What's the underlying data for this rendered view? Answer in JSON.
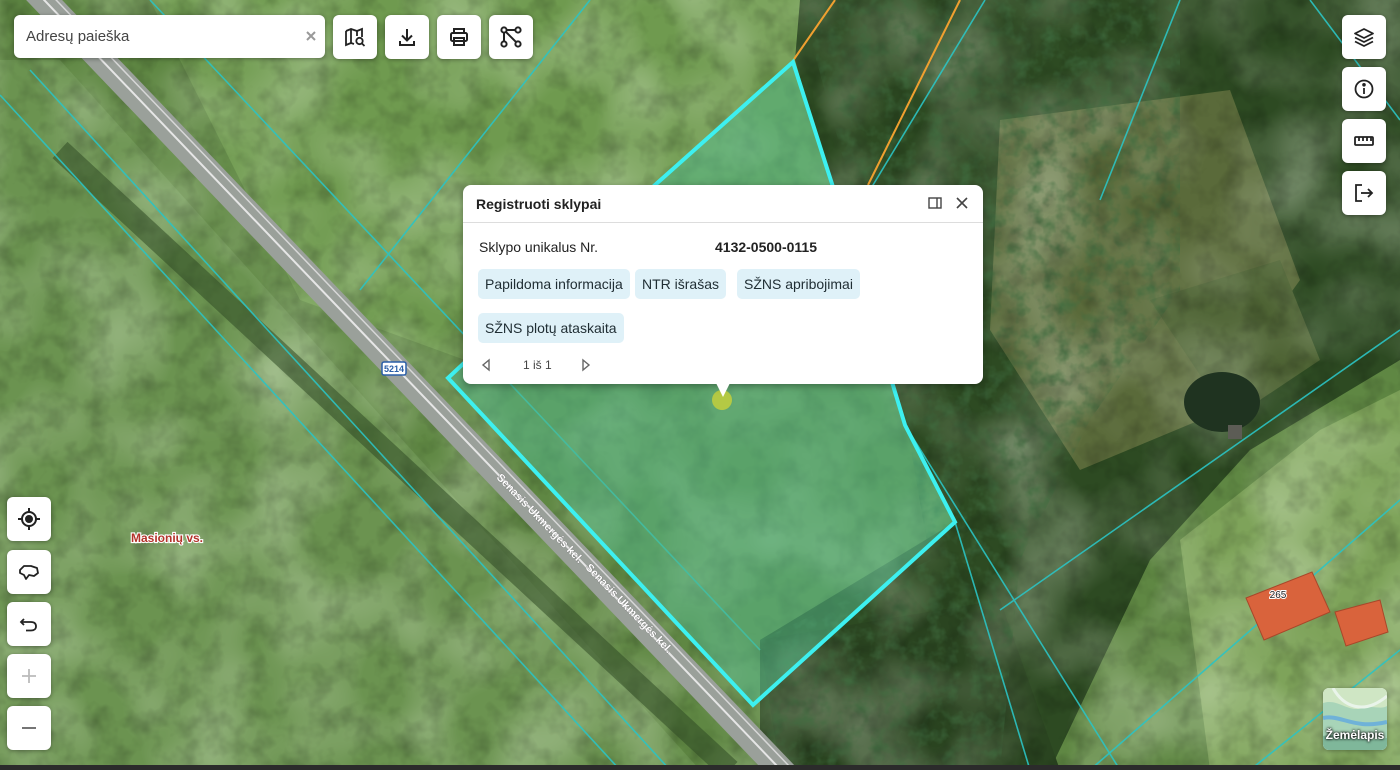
{
  "search": {
    "placeholder": "Adresų paieška",
    "value": ""
  },
  "toolbar": {
    "buttons": [
      {
        "name": "map-search-icon"
      },
      {
        "name": "download-icon"
      },
      {
        "name": "print-icon"
      },
      {
        "name": "route-icon"
      }
    ]
  },
  "right_controls": [
    {
      "name": "layers-icon"
    },
    {
      "name": "info-icon"
    },
    {
      "name": "ruler-icon"
    },
    {
      "name": "logout-icon"
    }
  ],
  "left_controls": [
    {
      "name": "locate-icon"
    },
    {
      "name": "lasso-icon"
    },
    {
      "name": "undo-icon"
    },
    {
      "name": "plus-icon"
    },
    {
      "name": "minus-icon"
    }
  ],
  "popup": {
    "title": "Registruoti sklypai",
    "field_label": "Sklypo unikalus Nr.",
    "field_value": "4132-0500-0115",
    "buttons": [
      "Papildoma informacija",
      "NTR išrašas",
      "SŽNS apribojimai",
      "SŽNS plotų ataskaita"
    ],
    "pagination": "1 iš 1"
  },
  "map_labels": {
    "road_number": "5214",
    "road_name": "Senasis Ukmergės kel.",
    "village": "Masionių vs.",
    "house_number": "265"
  },
  "basemap": {
    "label": "Žemėlapis"
  },
  "colors": {
    "parcel_outline": "#3df0f0",
    "parcel_fill": "#56b889",
    "boundary_line": "#2bc4c4",
    "utility_line": "#f0a030",
    "roof": "#d9633c"
  }
}
